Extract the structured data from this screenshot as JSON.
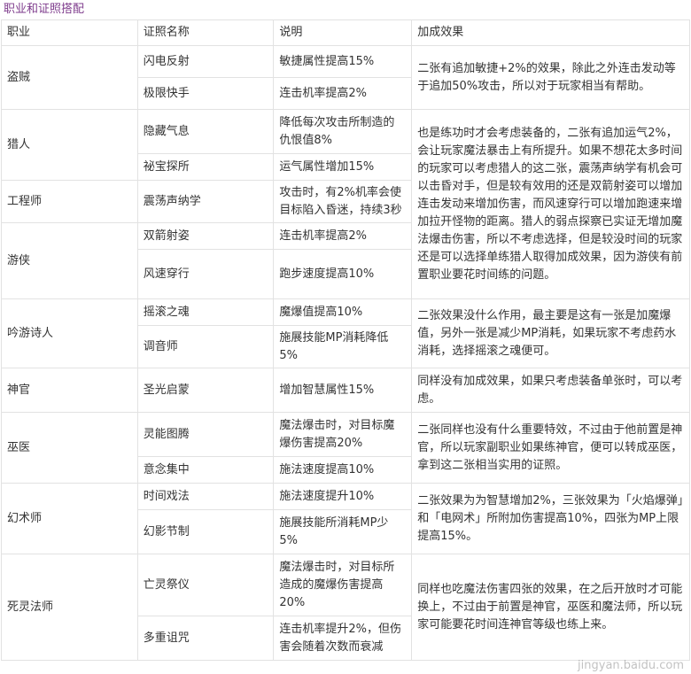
{
  "title": "职业和证照搭配",
  "headers": [
    "职业",
    "证照名称",
    "说明",
    "加成效果"
  ],
  "rows": {
    "r0": {
      "job": "盗贼",
      "name": "闪电反射",
      "desc": "敏捷属性提高15%",
      "effect": "二张有追加敏捷+2%的效果，除此之外连击发动等于追加50%攻击，所以对于玩家相当有帮助。"
    },
    "r1": {
      "name": "极限快手",
      "desc": "连击机率提高2%"
    },
    "r2": {
      "job": "猎人",
      "name": "隐藏气息",
      "desc": "降低每次攻击所制造的仇恨值8%",
      "effect": "也是练功时才会考虑装备的，二张有追加运气2%，会让玩家魔法暴击上有所提升。如果不想花太多时间的玩家可以考虑猎人的这二张，震荡声纳学有机会可以击昏对手，但是较有效用的还是双箭射姿可以增加连击发动来增加伤害，而风速穿行可以增加跑速来增加拉开怪物的距离。猎人的弱点探察已实证无增加魔法爆击伤害，所以不考虑选择，但是较没时间的玩家还是可以选择单练猎人取得加成效果，因为游侠有前置职业要花时间练的问题。"
    },
    "r3": {
      "name": "祕宝探所",
      "desc": "运气属性增加15%"
    },
    "r4": {
      "job": "工程师",
      "name": "震荡声纳学",
      "desc": "攻击时，有2%机率会使目标陷入昏迷，持续3秒"
    },
    "r5": {
      "job": "游侠",
      "name": "双箭射姿",
      "desc": "连击机率提高2%"
    },
    "r6": {
      "name": "风速穿行",
      "desc": "跑步速度提高10%"
    },
    "r7": {
      "job": "吟游诗人",
      "name": "摇滚之魂",
      "desc": "魔爆值提高10%",
      "effect": "二张效果没什么作用，最主要是这有一张是加魔爆值，另外一张是减少MP消耗，如果玩家不考虑药水消耗，选择摇滚之魂便可。"
    },
    "r8": {
      "name": "调音师",
      "desc": "施展技能MP消耗降低5%"
    },
    "r9": {
      "job": "神官",
      "name": "圣光启蒙",
      "desc": "增加智慧属性15%",
      "effect": "同样没有加成效果，如果只考虑装备单张时，可以考虑。"
    },
    "r10": {
      "job": "巫医",
      "name": "灵能图腾",
      "desc": "魔法爆击时，对目标魔爆伤害提高20%",
      "effect": "二张同样也没有什么重要特效，不过由于他前置是神官，所以玩家副职业如果练神官，便可以转成巫医，拿到这二张相当实用的证照。"
    },
    "r11": {
      "name": "意念集中",
      "desc": "施法速度提高10%"
    },
    "r12": {
      "job": "幻术师",
      "name": "时间戏法",
      "desc": "施法速度提升10%",
      "effect": "二张效果为为智慧增加2%，三张效果为「火焰爆弹」和「电网术」所附加伤害提高10%，四张为MP上限提高15%。"
    },
    "r13": {
      "name": "幻影节制",
      "desc": "施展技能所消耗MP少5%"
    },
    "r14": {
      "job": "死灵法师",
      "name": "亡灵祭仪",
      "desc": "魔法爆击时，对目标所造成的魔爆伤害提高20%",
      "effect": "同样也吃魔法伤害四张的效果，在之后开放时才可能换上，不过由于前置是神官，巫医和魔法师，所以玩家可能要花时间连神官等级也练上来。"
    },
    "r15": {
      "name": "多重诅咒",
      "desc": "连击机率提升2%，但伤害会随着次数而衰减"
    }
  },
  "watermark": "jingyan.baidu.com"
}
